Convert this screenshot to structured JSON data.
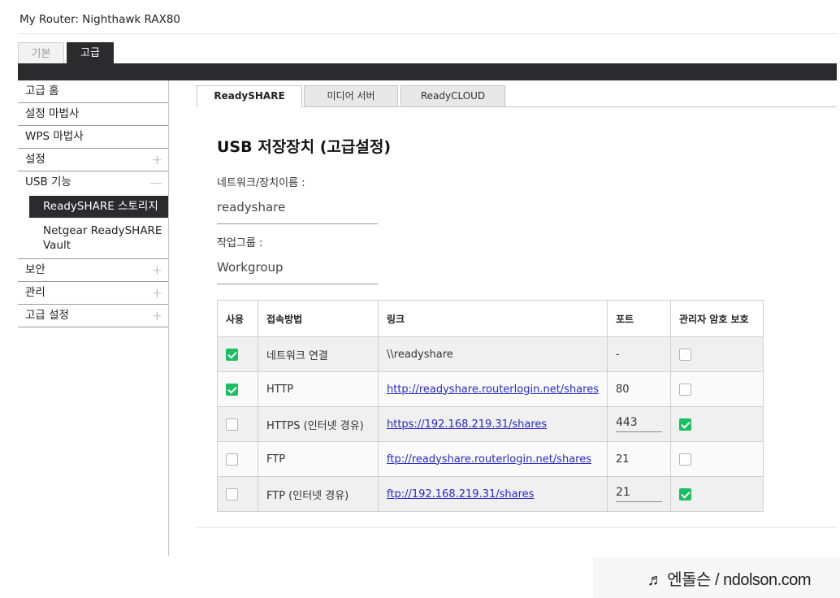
{
  "header": {
    "title": "My Router: Nighthawk RAX80"
  },
  "top_tabs": {
    "basic": "기본",
    "advanced": "고급"
  },
  "sidebar": {
    "items": [
      {
        "label": "고급 홈",
        "toggle": ""
      },
      {
        "label": "설정 마법사",
        "toggle": ""
      },
      {
        "label": "WPS 마법사",
        "toggle": ""
      },
      {
        "label": "설정",
        "toggle": "+"
      },
      {
        "label": "USB 기능",
        "toggle": "—"
      },
      {
        "label": "보안",
        "toggle": "+"
      },
      {
        "label": "관리",
        "toggle": "+"
      },
      {
        "label": "고급 설정",
        "toggle": "+"
      }
    ],
    "usb_sub": {
      "storage": "ReadySHARE 스토리지",
      "vault": "Netgear ReadySHARE Vault"
    }
  },
  "content_tabs": [
    "ReadySHARE",
    "미디어 서버",
    "ReadyCLOUD"
  ],
  "section": {
    "title": "USB 저장장치 (고급설정)",
    "device_name_label": "네트워크/장치이름 :",
    "device_name_value": "readyshare",
    "workgroup_label": "작업그룹 :",
    "workgroup_value": "Workgroup"
  },
  "table": {
    "headers": [
      "사용",
      "접속방법",
      "링크",
      "포트",
      "관리자 암호 보호"
    ],
    "rows": [
      {
        "enabled": true,
        "method": "네트워크 연결",
        "link": "\\\\readyshare",
        "link_is_url": false,
        "port": "-",
        "port_editable": false,
        "admin_protect": false
      },
      {
        "enabled": true,
        "method": "HTTP",
        "link": "http://readyshare.routerlogin.net/shares",
        "link_is_url": true,
        "port": "80",
        "port_editable": false,
        "admin_protect": false
      },
      {
        "enabled": false,
        "method": "HTTPS (인터넷 경유)",
        "link": "https://192.168.219.31/shares",
        "link_is_url": true,
        "port": "443",
        "port_editable": true,
        "admin_protect": true
      },
      {
        "enabled": false,
        "method": "FTP",
        "link": "ftp://readyshare.routerlogin.net/shares",
        "link_is_url": true,
        "port": "21",
        "port_editable": false,
        "admin_protect": false
      },
      {
        "enabled": false,
        "method": "FTP (인터넷 경유)",
        "link": "ftp://192.168.219.31/shares",
        "link_is_url": true,
        "port": "21",
        "port_editable": true,
        "admin_protect": true
      }
    ]
  },
  "watermark": {
    "text": "♬ 엔돌슨 / ndolson.com"
  },
  "colors": {
    "dark": "#2b2a2d",
    "check_green": "#1bbf61",
    "link_blue": "#2a2ac8"
  }
}
